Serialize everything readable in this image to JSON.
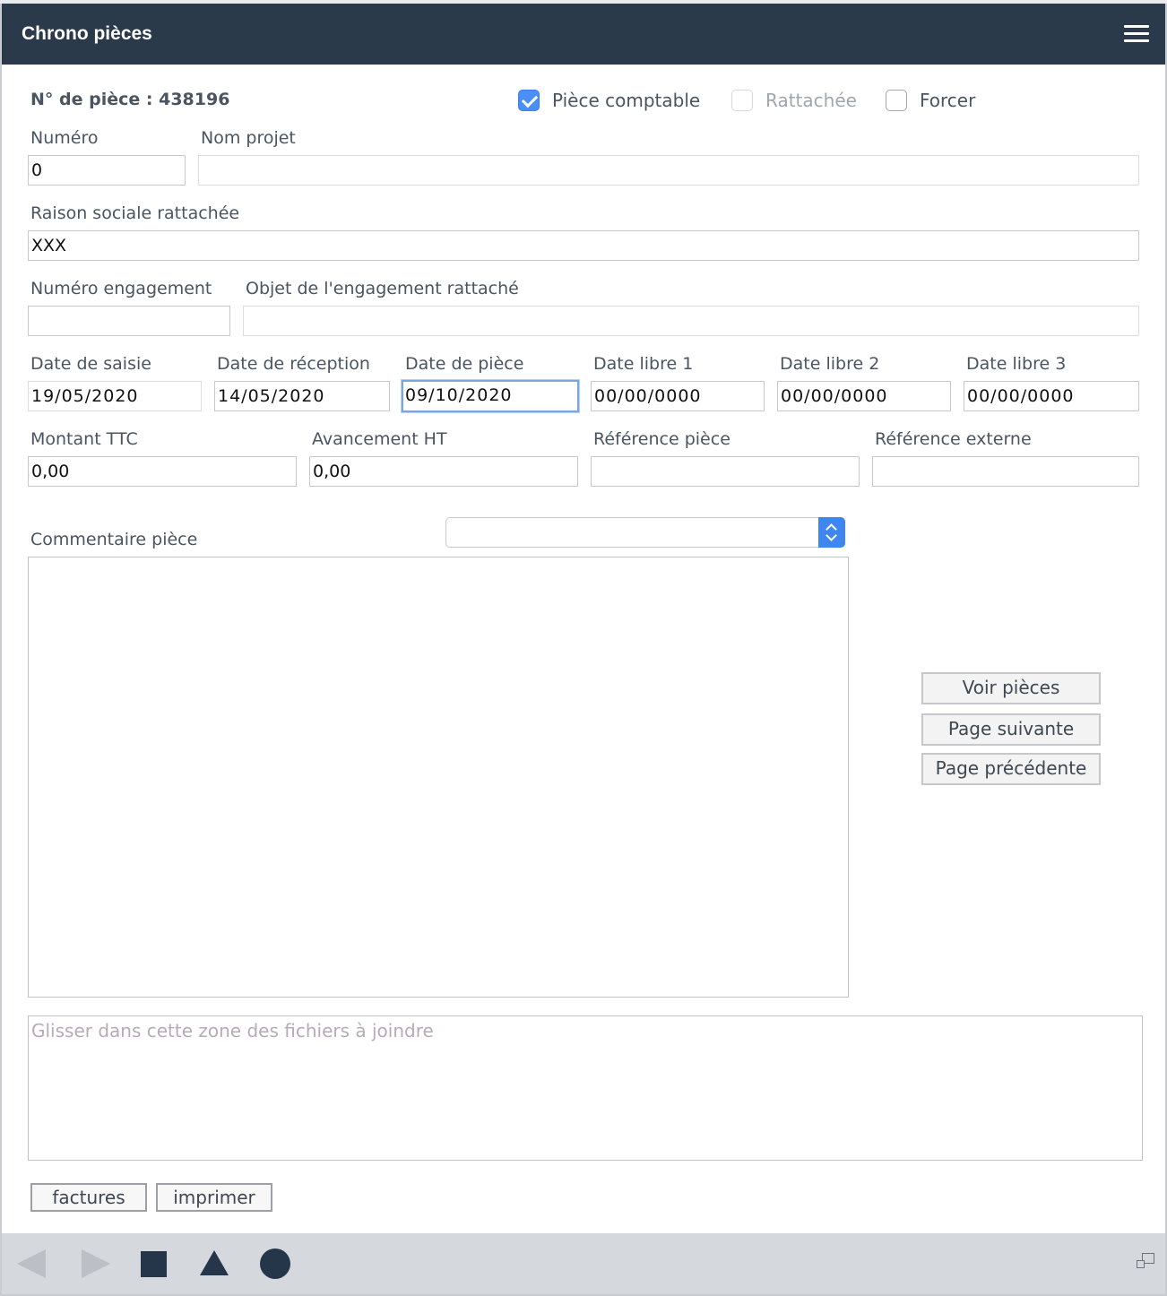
{
  "header": {
    "title": "Chrono pièces",
    "menu_icon": "hamburger-menu-icon"
  },
  "piece_number_label": "N° de pièce : 438196",
  "checkboxes": {
    "piece_comptable": {
      "label": "Pièce comptable",
      "checked": true
    },
    "rattachee": {
      "label": "Rattachée",
      "checked": false,
      "disabled": true
    },
    "forcer": {
      "label": "Forcer",
      "checked": false
    }
  },
  "fields": {
    "numero": {
      "label": "Numéro",
      "value": "0"
    },
    "nom_projet": {
      "label": "Nom projet",
      "value": ""
    },
    "raison_sociale": {
      "label": "Raison sociale rattachée",
      "value": "XXX"
    },
    "numero_engagement": {
      "label": "Numéro engagement",
      "value": ""
    },
    "objet_engagement": {
      "label": "Objet de l'engagement rattaché",
      "value": ""
    },
    "date_saisie": {
      "label": "Date de saisie",
      "value": "19/05/2020"
    },
    "date_reception": {
      "label": "Date de réception",
      "value": "14/05/2020"
    },
    "date_piece": {
      "label": "Date de pièce",
      "value": "09/10/2020"
    },
    "date_libre_1": {
      "label": "Date libre 1",
      "value": "00/00/0000"
    },
    "date_libre_2": {
      "label": "Date libre 2",
      "value": "00/00/0000"
    },
    "date_libre_3": {
      "label": "Date libre 3",
      "value": "00/00/0000"
    },
    "montant_ttc": {
      "label": "Montant TTC",
      "value": "0,00"
    },
    "avancement_ht": {
      "label": "Avancement HT",
      "value": "0,00"
    },
    "reference_piece": {
      "label": "Référence pièce",
      "value": ""
    },
    "reference_externe": {
      "label": "Référence externe",
      "value": ""
    }
  },
  "commentaire": {
    "label": "Commentaire pièce",
    "select_value": "",
    "text": ""
  },
  "buttons": {
    "voir_pieces": "Voir pièces",
    "page_suivante": "Page suivante",
    "page_precedente": "Page précédente",
    "factures": "factures",
    "imprimer": "imprimer"
  },
  "dropzone": {
    "placeholder": "Glisser dans cette zone des fichiers à joindre"
  },
  "bottom_bar": {
    "icons": [
      "back-icon",
      "forward-icon",
      "square-icon",
      "triangle-icon",
      "circle-icon",
      "resize-window-icon"
    ],
    "accent": "#25364a"
  },
  "colors": {
    "header_bg": "#2b3a4b",
    "checkbox_accent": "#4a8ff5",
    "select_accent": "#3f86f1"
  }
}
